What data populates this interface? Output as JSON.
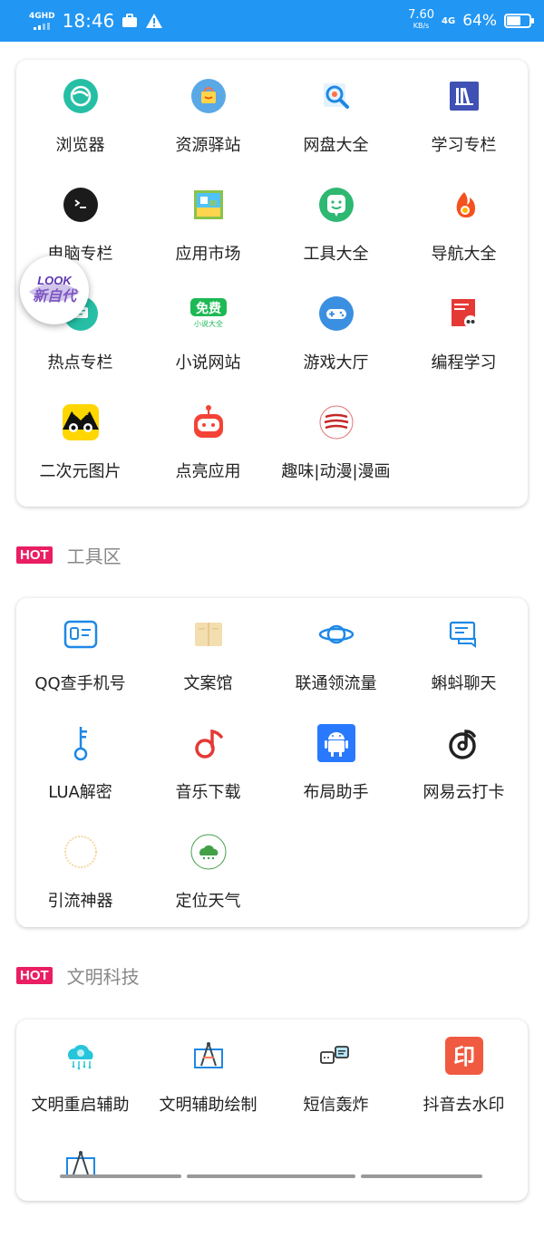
{
  "status_bar": {
    "network": "4GHD",
    "time": "18:46",
    "speed_value": "7.60",
    "speed_unit": "KB/s",
    "signal_label": "4G",
    "battery": "64%",
    "battery_level": 0.64
  },
  "card1": {
    "items": [
      {
        "label": "浏览器",
        "icon": "browser-icon"
      },
      {
        "label": "资源驿站",
        "icon": "resource-bag-icon"
      },
      {
        "label": "网盘大全",
        "icon": "netdisk-search-icon"
      },
      {
        "label": "学习专栏",
        "icon": "books-icon"
      },
      {
        "label": "电脑专栏",
        "icon": "terminal-icon"
      },
      {
        "label": "应用市场",
        "icon": "app-market-icon"
      },
      {
        "label": "工具大全",
        "icon": "toolbox-face-icon"
      },
      {
        "label": "导航大全",
        "icon": "flame-icon"
      },
      {
        "label": "热点专栏",
        "icon": "hot-chat-icon"
      },
      {
        "label": "小说网站",
        "icon": "free-novel-icon"
      },
      {
        "label": "游戏大厅",
        "icon": "gamepad-icon"
      },
      {
        "label": "编程学习",
        "icon": "code-book-icon"
      },
      {
        "label": "二次元图片",
        "icon": "anime-cat-icon"
      },
      {
        "label": "点亮应用",
        "icon": "robot-icon"
      },
      {
        "label": "趣味|动漫|漫画",
        "icon": "stripes-icon"
      }
    ]
  },
  "floating_badge": {
    "text": "LOOK 新自代"
  },
  "section_tools": {
    "badge": "HOT",
    "title": "工具区"
  },
  "card2": {
    "items": [
      {
        "label": "QQ查手机号",
        "icon": "id-card-icon"
      },
      {
        "label": "文案馆",
        "icon": "open-book-icon"
      },
      {
        "label": "联通领流量",
        "icon": "planet-icon"
      },
      {
        "label": "蝌蚪聊天",
        "icon": "chat-bubbles-icon"
      },
      {
        "label": "LUA解密",
        "icon": "key-icon"
      },
      {
        "label": "音乐下载",
        "icon": "music-note-icon"
      },
      {
        "label": "布局助手",
        "icon": "android-icon"
      },
      {
        "label": "网易云打卡",
        "icon": "netease-music-icon"
      },
      {
        "label": "引流神器",
        "icon": "ring-icon"
      },
      {
        "label": "定位天气",
        "icon": "weather-cloud-icon"
      }
    ]
  },
  "section_wenming": {
    "badge": "HOT",
    "title": "文明科技"
  },
  "card3": {
    "items": [
      {
        "label": "文明重启辅助",
        "icon": "cloud-brain-icon"
      },
      {
        "label": "文明辅助绘制",
        "icon": "compass-draw-icon"
      },
      {
        "label": "短信轰炸",
        "icon": "sms-icon"
      },
      {
        "label": "抖音去水印",
        "icon": "stamp-icon"
      },
      {
        "label": "",
        "icon": "compass-draw-icon"
      }
    ]
  },
  "colors": {
    "status_bar": "#2196f3",
    "hot_badge": "#e91e63",
    "section_title": "#888888"
  }
}
